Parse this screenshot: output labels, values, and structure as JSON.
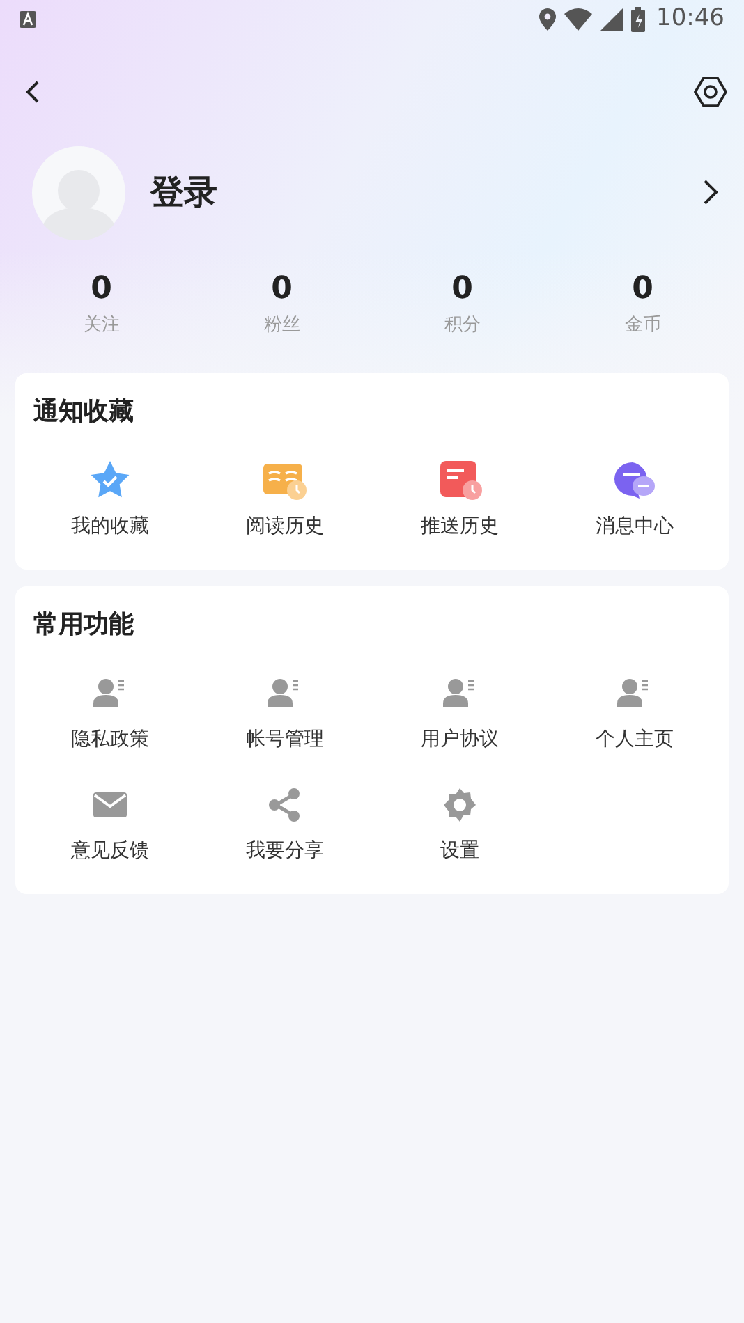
{
  "status_bar": {
    "time": "10:46"
  },
  "profile": {
    "name": "登录"
  },
  "stats": [
    {
      "value": "0",
      "label": "关注"
    },
    {
      "value": "0",
      "label": "粉丝"
    },
    {
      "value": "0",
      "label": "积分"
    },
    {
      "value": "0",
      "label": "金币"
    }
  ],
  "sections": [
    {
      "title": "通知收藏",
      "items": [
        {
          "label": "我的收藏",
          "kind": "star"
        },
        {
          "label": "阅读历史",
          "kind": "book"
        },
        {
          "label": "推送历史",
          "kind": "note"
        },
        {
          "label": "消息中心",
          "kind": "chat"
        }
      ]
    },
    {
      "title": "常用功能",
      "items": [
        {
          "label": "隐私政策",
          "kind": "person"
        },
        {
          "label": "帐号管理",
          "kind": "person"
        },
        {
          "label": "用户协议",
          "kind": "person"
        },
        {
          "label": "个人主页",
          "kind": "person"
        },
        {
          "label": "意见反馈",
          "kind": "mail"
        },
        {
          "label": "我要分享",
          "kind": "share"
        },
        {
          "label": "设置",
          "kind": "gear"
        }
      ]
    }
  ]
}
